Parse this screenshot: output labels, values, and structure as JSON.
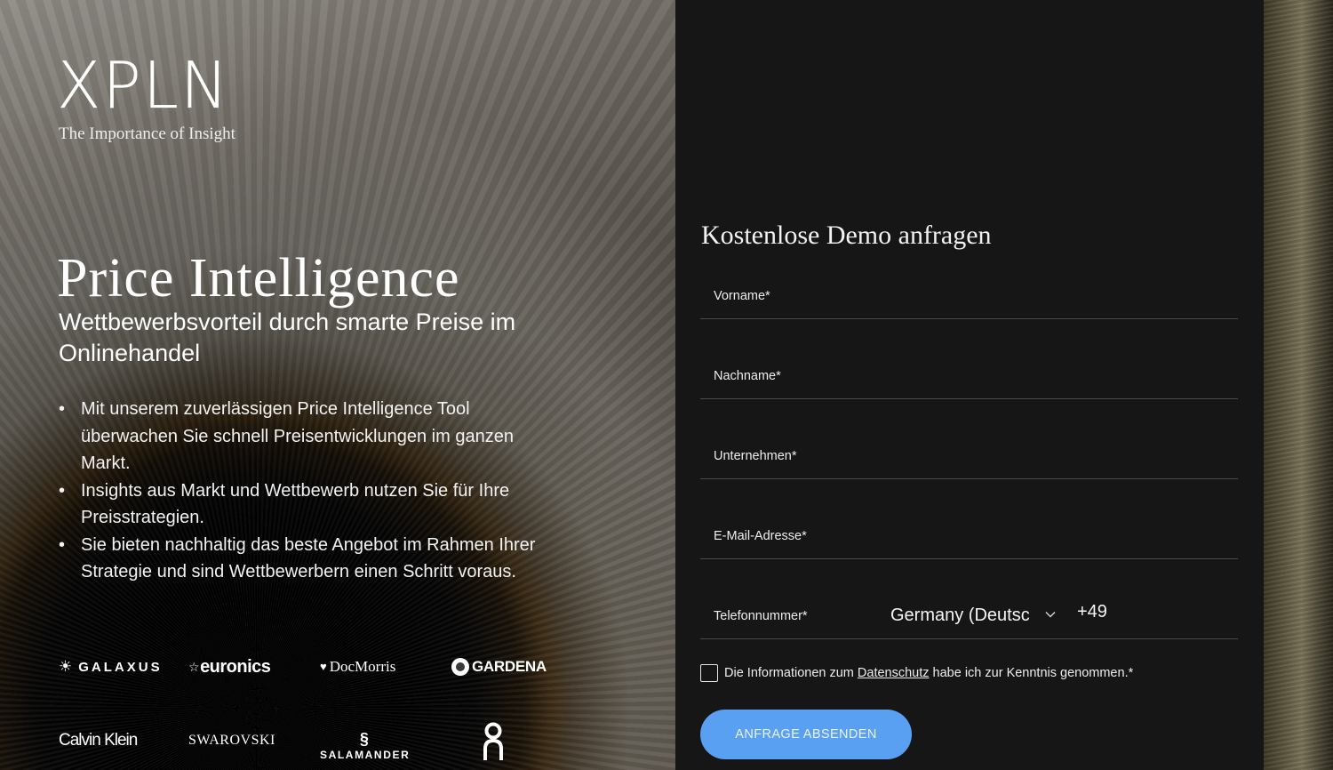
{
  "logo": {
    "mark": "XPLN",
    "tagline": "The Importance of Insight"
  },
  "hero": {
    "title": "Price Intelligence",
    "subtitle": "Wettbewerbsvorteil durch smarte Preise im Onlinehandel",
    "bullets": [
      "Mit unserem zuverlässigen Price Intelligence Tool überwachen Sie schnell Preisentwicklungen im ganzen Markt.",
      "Insights aus Markt und Wettbewerb nutzen Sie für Ihre Preisstrategien.",
      "Sie bieten nachhaltig das beste Angebot im Rahmen Ihrer Strategie und sind Wettbewerbern einen Schritt voraus."
    ]
  },
  "brands": {
    "galaxus": "GALAXUS",
    "euronics": "euronics",
    "docmorris": "DocMorris",
    "gardena": "GARDENA",
    "calvin_klein": "Calvin Klein",
    "swarovski": "SWAROVSKI",
    "salamander": "SALAMANDER",
    "on": "On"
  },
  "form": {
    "title": "Kostenlose Demo anfragen",
    "fields": {
      "first_name": "Vorname*",
      "last_name": "Nachname*",
      "company": "Unternehmen*",
      "email": "E-Mail-Adresse*",
      "phone": "Telefonnummer*"
    },
    "phone_country": "Germany (Deutschland)",
    "phone_dial_code": "+49",
    "consent": {
      "before": "Die Informationen zum ",
      "link": "Datenschutz",
      "after": " habe ich zur Kenntnis genommen.*"
    },
    "submit_label": "ANFRAGE ABSENDEN"
  },
  "colors": {
    "accent": "#5aa0f2",
    "panel": "#161616",
    "divider": "#4b4b4b"
  }
}
